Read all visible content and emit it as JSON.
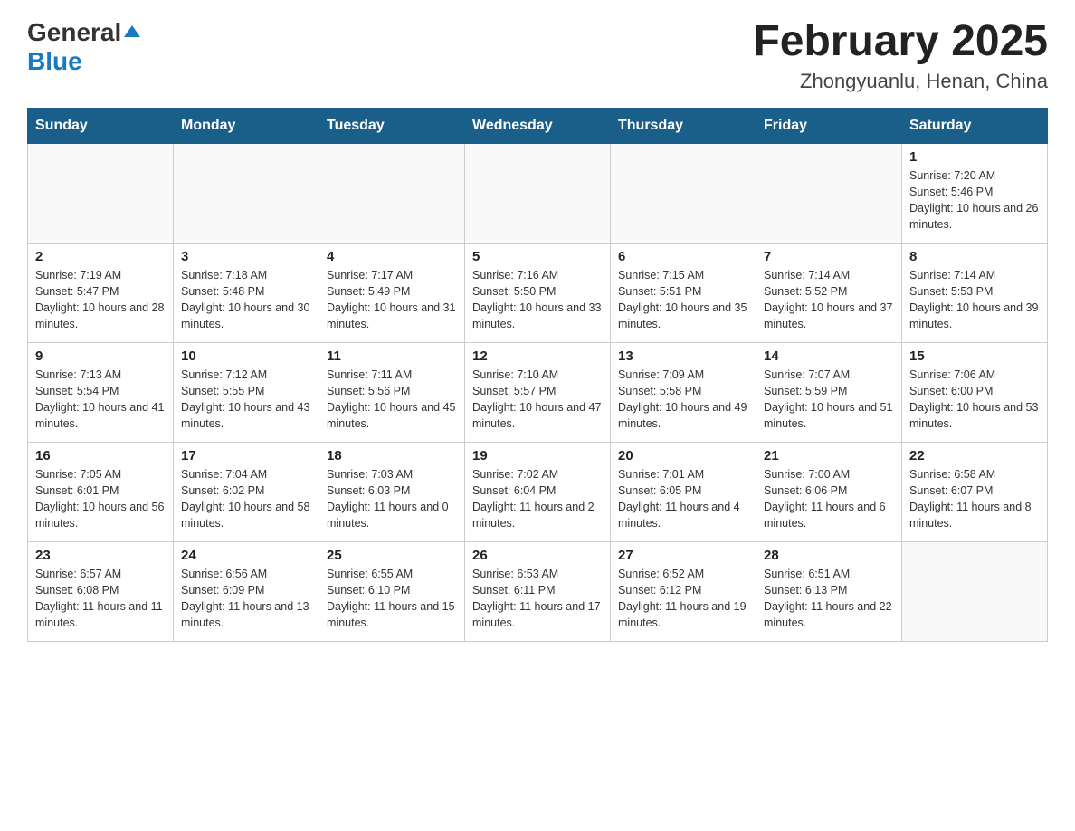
{
  "header": {
    "logo_general": "General",
    "logo_blue": "Blue",
    "month_title": "February 2025",
    "location": "Zhongyuanlu, Henan, China"
  },
  "days_of_week": [
    "Sunday",
    "Monday",
    "Tuesday",
    "Wednesday",
    "Thursday",
    "Friday",
    "Saturday"
  ],
  "weeks": [
    [
      {
        "day": "",
        "info": ""
      },
      {
        "day": "",
        "info": ""
      },
      {
        "day": "",
        "info": ""
      },
      {
        "day": "",
        "info": ""
      },
      {
        "day": "",
        "info": ""
      },
      {
        "day": "",
        "info": ""
      },
      {
        "day": "1",
        "info": "Sunrise: 7:20 AM\nSunset: 5:46 PM\nDaylight: 10 hours and 26 minutes."
      }
    ],
    [
      {
        "day": "2",
        "info": "Sunrise: 7:19 AM\nSunset: 5:47 PM\nDaylight: 10 hours and 28 minutes."
      },
      {
        "day": "3",
        "info": "Sunrise: 7:18 AM\nSunset: 5:48 PM\nDaylight: 10 hours and 30 minutes."
      },
      {
        "day": "4",
        "info": "Sunrise: 7:17 AM\nSunset: 5:49 PM\nDaylight: 10 hours and 31 minutes."
      },
      {
        "day": "5",
        "info": "Sunrise: 7:16 AM\nSunset: 5:50 PM\nDaylight: 10 hours and 33 minutes."
      },
      {
        "day": "6",
        "info": "Sunrise: 7:15 AM\nSunset: 5:51 PM\nDaylight: 10 hours and 35 minutes."
      },
      {
        "day": "7",
        "info": "Sunrise: 7:14 AM\nSunset: 5:52 PM\nDaylight: 10 hours and 37 minutes."
      },
      {
        "day": "8",
        "info": "Sunrise: 7:14 AM\nSunset: 5:53 PM\nDaylight: 10 hours and 39 minutes."
      }
    ],
    [
      {
        "day": "9",
        "info": "Sunrise: 7:13 AM\nSunset: 5:54 PM\nDaylight: 10 hours and 41 minutes."
      },
      {
        "day": "10",
        "info": "Sunrise: 7:12 AM\nSunset: 5:55 PM\nDaylight: 10 hours and 43 minutes."
      },
      {
        "day": "11",
        "info": "Sunrise: 7:11 AM\nSunset: 5:56 PM\nDaylight: 10 hours and 45 minutes."
      },
      {
        "day": "12",
        "info": "Sunrise: 7:10 AM\nSunset: 5:57 PM\nDaylight: 10 hours and 47 minutes."
      },
      {
        "day": "13",
        "info": "Sunrise: 7:09 AM\nSunset: 5:58 PM\nDaylight: 10 hours and 49 minutes."
      },
      {
        "day": "14",
        "info": "Sunrise: 7:07 AM\nSunset: 5:59 PM\nDaylight: 10 hours and 51 minutes."
      },
      {
        "day": "15",
        "info": "Sunrise: 7:06 AM\nSunset: 6:00 PM\nDaylight: 10 hours and 53 minutes."
      }
    ],
    [
      {
        "day": "16",
        "info": "Sunrise: 7:05 AM\nSunset: 6:01 PM\nDaylight: 10 hours and 56 minutes."
      },
      {
        "day": "17",
        "info": "Sunrise: 7:04 AM\nSunset: 6:02 PM\nDaylight: 10 hours and 58 minutes."
      },
      {
        "day": "18",
        "info": "Sunrise: 7:03 AM\nSunset: 6:03 PM\nDaylight: 11 hours and 0 minutes."
      },
      {
        "day": "19",
        "info": "Sunrise: 7:02 AM\nSunset: 6:04 PM\nDaylight: 11 hours and 2 minutes."
      },
      {
        "day": "20",
        "info": "Sunrise: 7:01 AM\nSunset: 6:05 PM\nDaylight: 11 hours and 4 minutes."
      },
      {
        "day": "21",
        "info": "Sunrise: 7:00 AM\nSunset: 6:06 PM\nDaylight: 11 hours and 6 minutes."
      },
      {
        "day": "22",
        "info": "Sunrise: 6:58 AM\nSunset: 6:07 PM\nDaylight: 11 hours and 8 minutes."
      }
    ],
    [
      {
        "day": "23",
        "info": "Sunrise: 6:57 AM\nSunset: 6:08 PM\nDaylight: 11 hours and 11 minutes."
      },
      {
        "day": "24",
        "info": "Sunrise: 6:56 AM\nSunset: 6:09 PM\nDaylight: 11 hours and 13 minutes."
      },
      {
        "day": "25",
        "info": "Sunrise: 6:55 AM\nSunset: 6:10 PM\nDaylight: 11 hours and 15 minutes."
      },
      {
        "day": "26",
        "info": "Sunrise: 6:53 AM\nSunset: 6:11 PM\nDaylight: 11 hours and 17 minutes."
      },
      {
        "day": "27",
        "info": "Sunrise: 6:52 AM\nSunset: 6:12 PM\nDaylight: 11 hours and 19 minutes."
      },
      {
        "day": "28",
        "info": "Sunrise: 6:51 AM\nSunset: 6:13 PM\nDaylight: 11 hours and 22 minutes."
      },
      {
        "day": "",
        "info": ""
      }
    ]
  ]
}
